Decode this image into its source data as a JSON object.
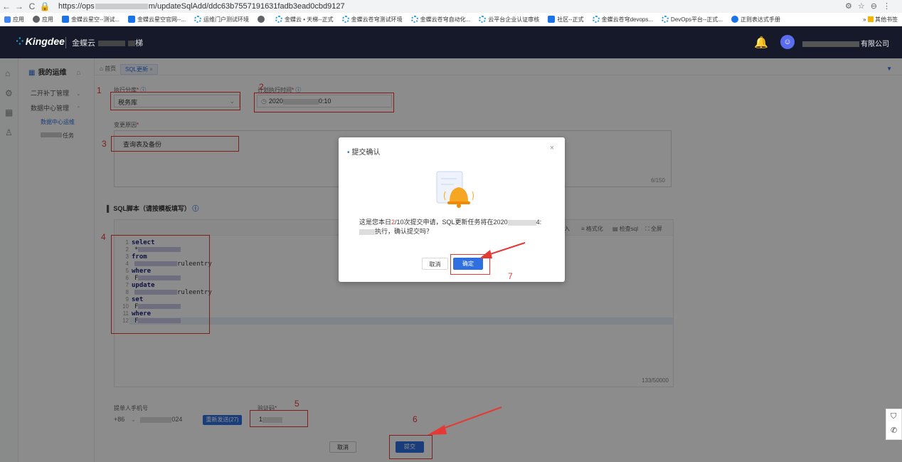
{
  "browser": {
    "url_prefix": "https://ops",
    "url_suffix": "m/updateSqlAdd/ddc63b7557191631fadb3ead0cbd9127",
    "bookmarks": [
      "应用",
      "应用",
      "金蝶云星空--测试...",
      "金蝶云星空官网--...",
      "运维门户测试环境",
      "",
      "金蝶云 • 天梯--正式",
      "金蝶云苍穹测试环境",
      "金蝶云苍穹自动化...",
      "云平台企业认证审核",
      "社区--正式",
      "金蝶云苍穹devops...",
      "DevOps平台--正式...",
      "正则表达式手册"
    ],
    "other_bookmarks": "其他书签"
  },
  "header": {
    "logo": "Kingdee",
    "app": "金蝶云",
    "app_suffix": "梯",
    "company": "有限公司"
  },
  "sidebar": {
    "title": "我的运维",
    "items": [
      {
        "label": "二开补丁管理"
      },
      {
        "label": "数据中心管理"
      }
    ],
    "subitems": [
      "数据中心运维",
      "任务"
    ]
  },
  "tabs": {
    "home": "首页",
    "active": "SQL更新"
  },
  "form": {
    "db_label": "执行分库",
    "db_value": "税务库",
    "time_label": "计划执行时间",
    "time_value_prefix": "2020",
    "time_value_suffix": "0:10",
    "reason_label": "变更原因",
    "reason_value": "查询表及备份",
    "reason_count": "6/150",
    "sql_label": "SQL脚本（请按模板填写）",
    "editor_tools": [
      "入",
      "≡ 格式化",
      "▤ 检查sql",
      "⛶ 全屏"
    ],
    "code_lines": [
      {
        "n": "1",
        "t": "select",
        "kw": true
      },
      {
        "n": "2",
        "t": "*",
        "kw": false
      },
      {
        "n": "3",
        "t": "from",
        "kw": true
      },
      {
        "n": "4",
        "t": "ruleentry",
        "kw": false
      },
      {
        "n": "5",
        "t": "where",
        "kw": true
      },
      {
        "n": "6",
        "t": "F",
        "kw": false
      },
      {
        "n": "7",
        "t": "update",
        "kw": true
      },
      {
        "n": "8",
        "t": "ruleentry",
        "kw": false
      },
      {
        "n": "9",
        "t": "set",
        "kw": true
      },
      {
        "n": "10",
        "t": "F",
        "kw": false
      },
      {
        "n": "11",
        "t": "where",
        "kw": true
      },
      {
        "n": "12",
        "t": "F",
        "kw": false
      }
    ],
    "code_count": "133/50000",
    "phone_label": "提单人手机号",
    "phone_prefix": "+86",
    "phone_suffix": "024",
    "resend_label": "重新发送(27)",
    "code_label": "验证码",
    "code_value": "1",
    "cancel": "取消",
    "submit": "提交"
  },
  "annotations": [
    "1",
    "2",
    "3",
    "4",
    "5",
    "6",
    "7"
  ],
  "modal": {
    "title": "提交确认",
    "msg_before": "这是您本日",
    "msg_count": "2",
    "msg_after_count": "/10次提交申请，SQL更新任务将在2020",
    "msg_after_blur": "4:",
    "msg_line2": "执行，确认提交吗？",
    "cancel": "取消",
    "ok": "确定"
  },
  "colors": {
    "primary": "#2f6fe0",
    "annotation_red": "#e53935",
    "header_bg": "#15192a"
  }
}
